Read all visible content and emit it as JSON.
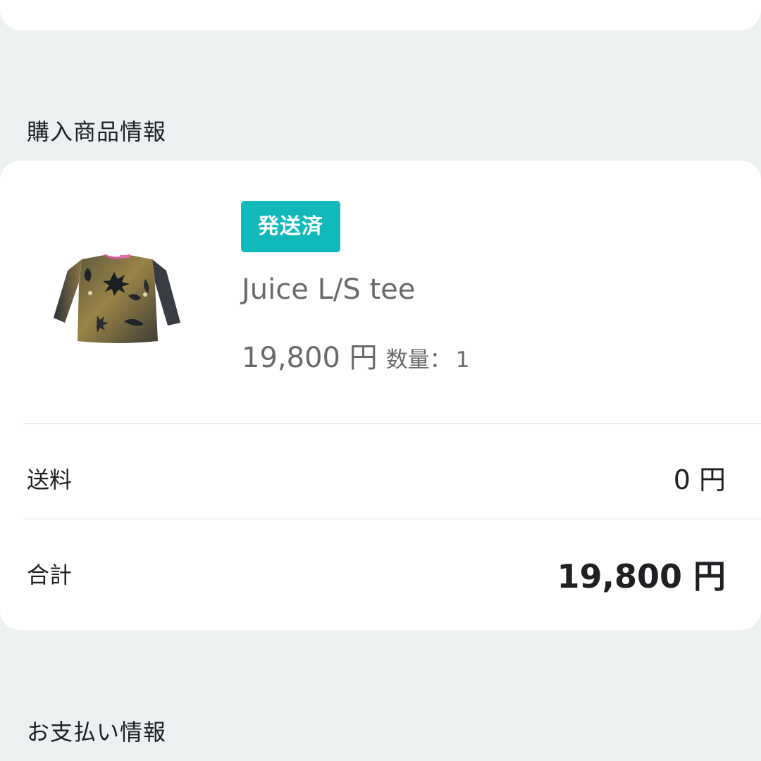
{
  "sections": {
    "purchase_info_heading": "購入商品情報",
    "payment_info_heading": "お支払い情報"
  },
  "product": {
    "status_badge": "発送済",
    "name": "Juice L/S tee",
    "unit_price": "19,800 円",
    "quantity_label": "数量：",
    "quantity_value": "1",
    "image_icon": "tie-dye-long-sleeve-tee-icon"
  },
  "summary": {
    "shipping_label": "送料",
    "shipping_value": "0 円",
    "total_label": "合計",
    "total_value": "19,800 円"
  },
  "colors": {
    "page_background": "#ebf0f0",
    "card_background": "#ffffff",
    "status_badge": "#12b9bb",
    "secondary_text": "#6a6a6e",
    "primary_text": "#1f1f24"
  }
}
